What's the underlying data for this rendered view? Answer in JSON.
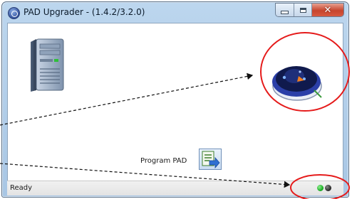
{
  "window": {
    "title": "PAD Upgrader - (1.4.2/3.2.0)",
    "close_glyph": "✕"
  },
  "main": {
    "program_label": "Program PAD"
  },
  "status": {
    "text": "Ready",
    "indicators": [
      "green",
      "dark"
    ]
  },
  "colors": {
    "highlight_circle": "#e51b1b",
    "status_green": "#0fa31a",
    "status_dark": "#222222"
  },
  "icons": [
    "app-icon",
    "computer-tower-icon",
    "aed-device-icon",
    "program-pad-icon"
  ]
}
